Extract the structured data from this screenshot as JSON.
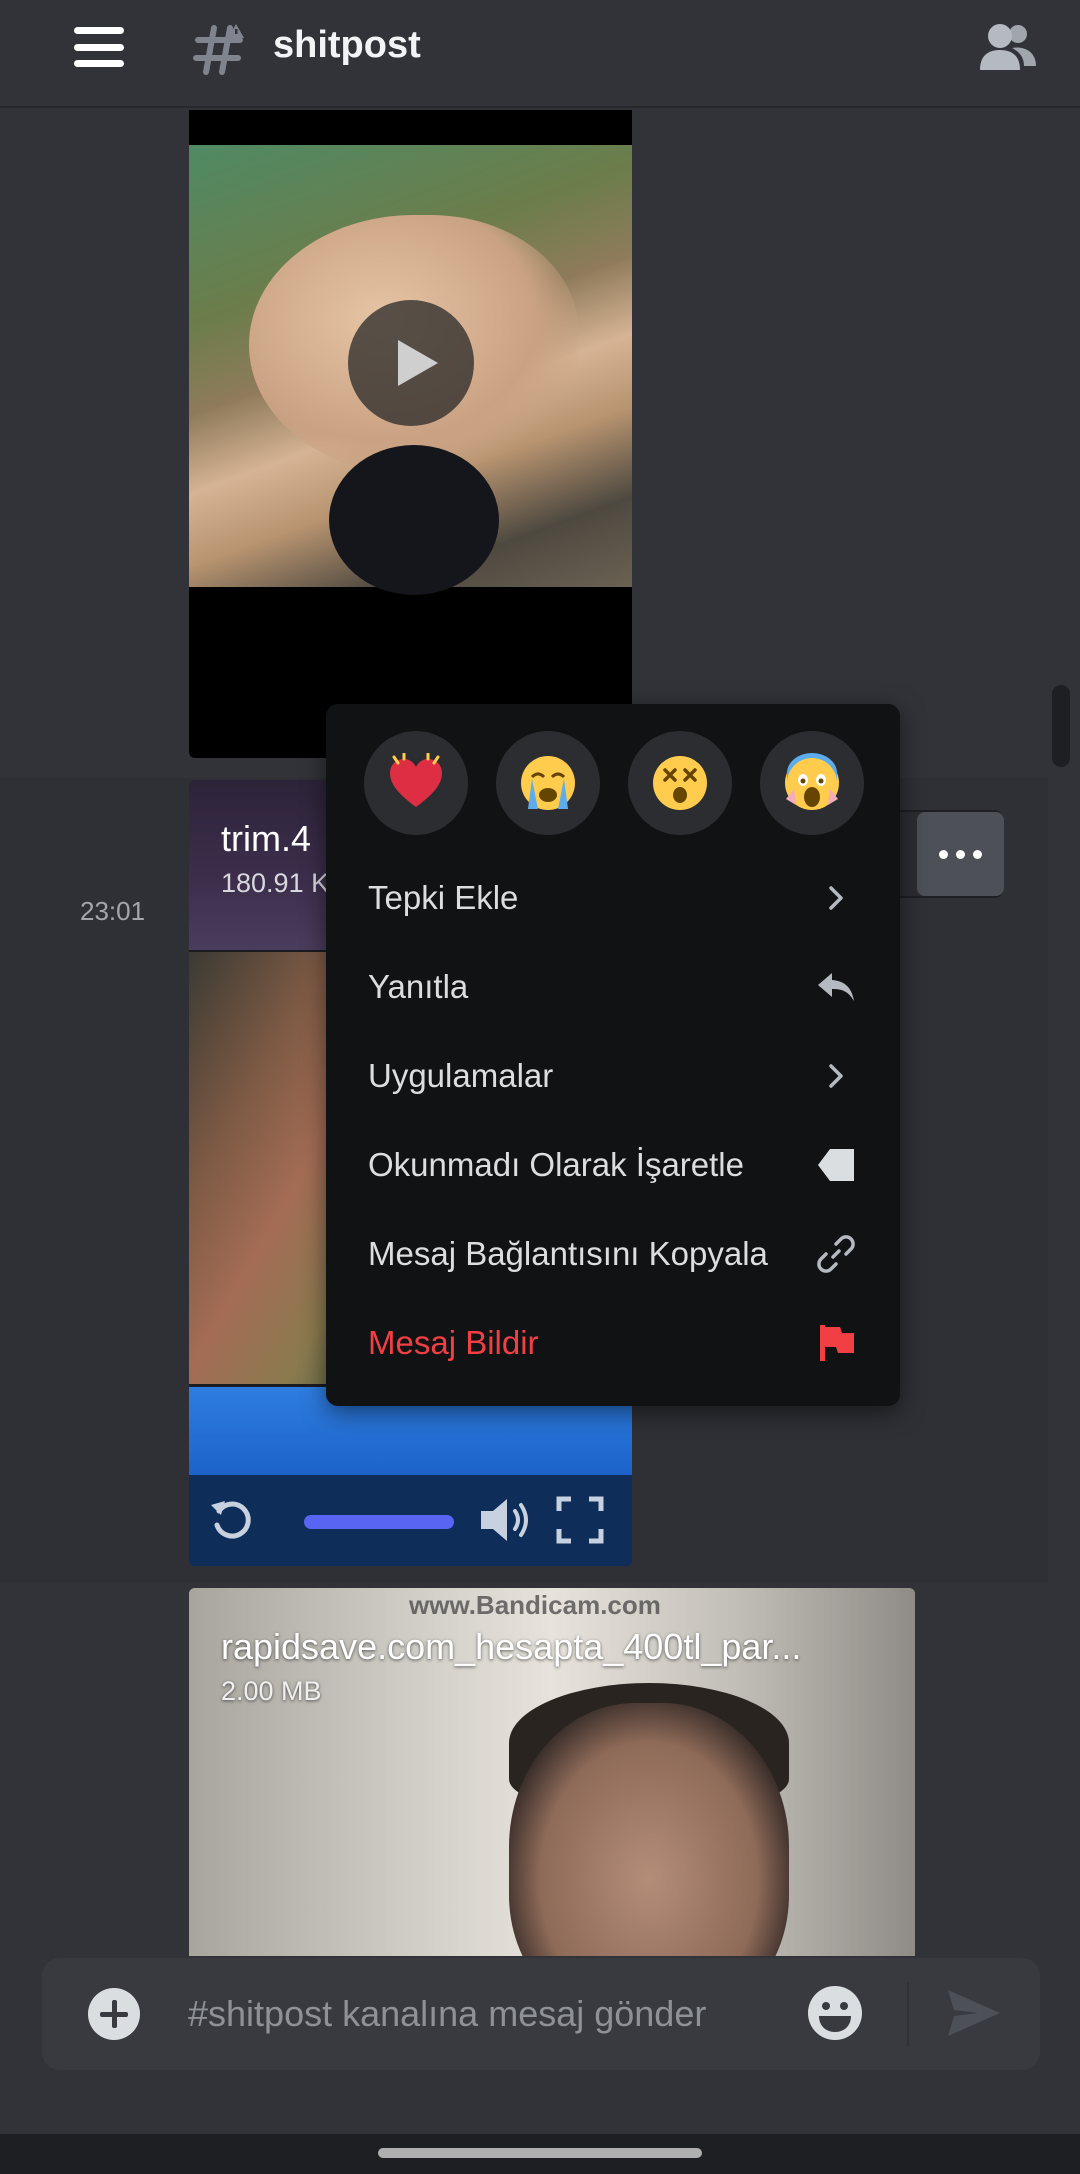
{
  "header": {
    "channel_name": "shitpost",
    "menu_icon": "hamburger-icon",
    "channel_icon": "text-channel-hash-icon",
    "members_icon": "members-icon"
  },
  "messages": [
    {
      "type": "video",
      "play_icon": "play-icon"
    },
    {
      "timestamp": "23:01",
      "type": "video",
      "file_name": "trim.4",
      "file_size": "180.91 K",
      "controls": [
        "replay-icon",
        "seek-bar",
        "volume-icon",
        "fullscreen-icon"
      ]
    },
    {
      "type": "video",
      "watermark": "www.Bandicam.com",
      "file_name": "rapidsave.com_hesapta_400tl_par...",
      "file_size": "2.00 MB"
    }
  ],
  "context_menu": {
    "reactions": [
      "heart-emoji-icon",
      "loudly-crying-emoji-icon",
      "dizzy-face-emoji-icon",
      "screaming-emoji-icon"
    ],
    "items": [
      {
        "label": "Tepki Ekle",
        "icon": "chevron-right-icon"
      },
      {
        "label": "Yanıtla",
        "icon": "reply-icon"
      },
      {
        "label": "Uygulamalar",
        "icon": "chevron-right-icon"
      },
      {
        "label": "Okunmadı Olarak İşaretle",
        "icon": "mark-unread-icon"
      },
      {
        "label": "Mesaj Bağlantısını Kopyala",
        "icon": "link-icon"
      },
      {
        "label": "Mesaj Bildir",
        "icon": "flag-icon",
        "danger": true
      }
    ]
  },
  "composer": {
    "placeholder": "#shitpost kanalına mesaj gönder",
    "value": ""
  },
  "colors": {
    "background": "#313338",
    "menu_background": "#111214",
    "danger": "#f23f43",
    "accent": "#5865f2"
  }
}
